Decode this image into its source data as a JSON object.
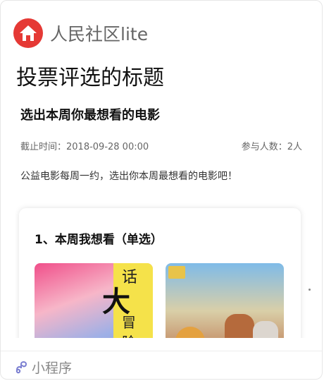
{
  "app": {
    "name": "人民社区lite",
    "logo_icon": "home-icon",
    "brand_color": "#e53935"
  },
  "page": {
    "title": "投票评选的标题"
  },
  "vote": {
    "title": "选出本周你最想看的电影",
    "deadline": "截止时间：2018-09-28 00:00",
    "participants": "参与人数：2人",
    "description": "公益电影每周一约，选出你本周最想看的电影吧！"
  },
  "question": {
    "title": "1、本周我想看（单选）"
  },
  "poster1": {
    "c1": "话",
    "c2": "大",
    "c3": "冒",
    "c4": "险"
  },
  "footer": {
    "label": "小程序",
    "icon": "mini-program-icon"
  }
}
